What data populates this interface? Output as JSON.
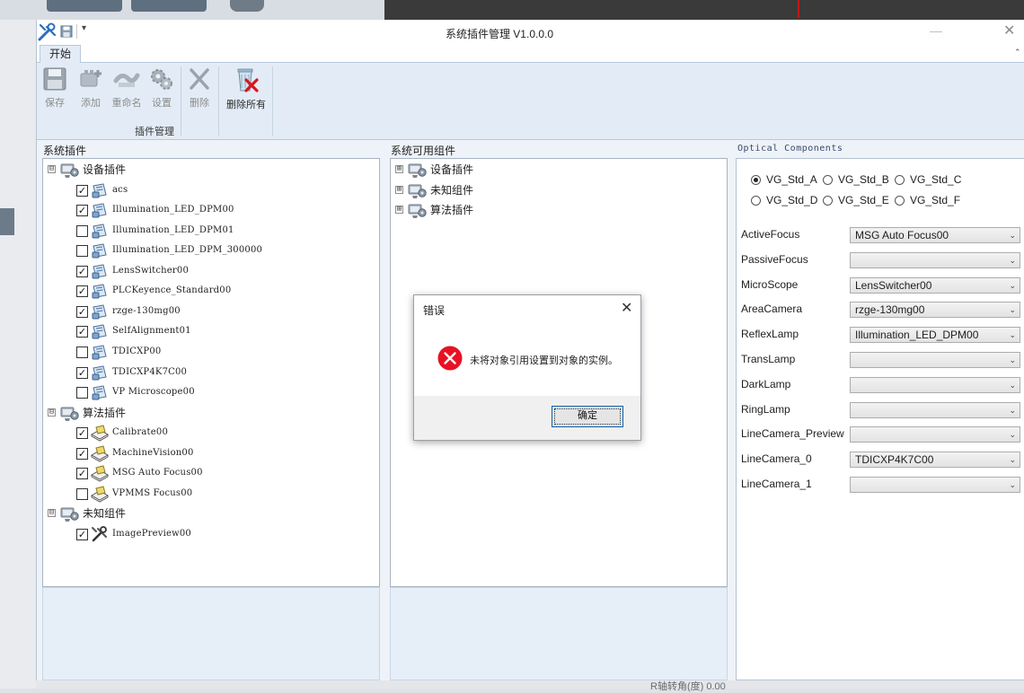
{
  "window": {
    "title": "系统插件管理 V1.0.0.0",
    "minimize_glyph": "—",
    "close_glyph": "✕",
    "qat_more_glyph": "▾",
    "collapse_glyph": "⌃"
  },
  "ribbon": {
    "tab_label": "开始",
    "group_label": "插件管理",
    "buttons": {
      "save": {
        "label": "保存",
        "icon": "floppy-icon"
      },
      "add": {
        "label": "添加",
        "icon": "add-plugin-icon"
      },
      "rename": {
        "label": "重命名",
        "icon": "rename-icon"
      },
      "settings": {
        "label": "设置",
        "icon": "gears-icon"
      },
      "delete": {
        "label": "删除",
        "icon": "delete-x-icon"
      },
      "delete_all": {
        "label": "删除所有",
        "icon": "recycle-bin-delete-icon"
      }
    }
  },
  "system_plugins": {
    "title": "系统插件",
    "groups": [
      {
        "label": "设备插件",
        "expanded": true,
        "expander": "⊟",
        "items": [
          {
            "label": "acs",
            "checked": true
          },
          {
            "label": "Illumination_LED_DPM00",
            "checked": true
          },
          {
            "label": "Illumination_LED_DPM01",
            "checked": false
          },
          {
            "label": "Illumination_LED_DPM_300000",
            "checked": false
          },
          {
            "label": "LensSwitcher00",
            "checked": true
          },
          {
            "label": "PLCKeyence_Standard00",
            "checked": true
          },
          {
            "label": "rzge-130mg00",
            "checked": true
          },
          {
            "label": "SelfAlignment01",
            "checked": true
          },
          {
            "label": "TDICXP00",
            "checked": false
          },
          {
            "label": "TDICXP4K7C00",
            "checked": true
          },
          {
            "label": "VP Microscope00",
            "checked": false
          }
        ]
      },
      {
        "label": "算法插件",
        "expanded": true,
        "expander": "⊟",
        "items": [
          {
            "label": "Calibrate00",
            "checked": true
          },
          {
            "label": "MachineVision00",
            "checked": true
          },
          {
            "label": "MSG Auto Focus00",
            "checked": true
          },
          {
            "label": "VPMMS Focus00",
            "checked": false
          }
        ]
      },
      {
        "label": "未知组件",
        "expanded": true,
        "expander": "⊟",
        "items": [
          {
            "label": "ImagePreview00",
            "checked": true
          }
        ]
      }
    ]
  },
  "available_components": {
    "title": "系统可用组件",
    "groups": [
      {
        "label": "设备插件",
        "expander": "⊞"
      },
      {
        "label": "未知组件",
        "expander": "⊞"
      },
      {
        "label": "算法插件",
        "expander": "⊞"
      }
    ]
  },
  "optical_components": {
    "title": "Optical Components",
    "radios": [
      {
        "label": "VG_Std_A",
        "selected": true
      },
      {
        "label": "VG_Std_B",
        "selected": false
      },
      {
        "label": "VG_Std_C",
        "selected": false
      },
      {
        "label": "VG_Std_D",
        "selected": false
      },
      {
        "label": "VG_Std_E",
        "selected": false
      },
      {
        "label": "VG_Std_F",
        "selected": false
      }
    ],
    "properties": [
      {
        "label": "ActiveFocus",
        "value": "MSG Auto Focus00"
      },
      {
        "label": "PassiveFocus",
        "value": ""
      },
      {
        "label": "MicroScope",
        "value": "LensSwitcher00"
      },
      {
        "label": "AreaCamera",
        "value": "rzge-130mg00"
      },
      {
        "label": "ReflexLamp",
        "value": "Illumination_LED_DPM00"
      },
      {
        "label": "TransLamp",
        "value": ""
      },
      {
        "label": "DarkLamp",
        "value": ""
      },
      {
        "label": "RingLamp",
        "value": ""
      },
      {
        "label": "LineCamera_Preview",
        "value": ""
      },
      {
        "label": "LineCamera_0",
        "value": "TDICXP4K7C00"
      },
      {
        "label": "LineCamera_1",
        "value": ""
      }
    ],
    "combo_arrow": "⌄"
  },
  "error_dialog": {
    "title": "错误",
    "message": "未将对象引用设置到对象的实例。",
    "ok_label": "确定",
    "close_glyph": "✕",
    "icon": "error-circle-icon",
    "accent": "#e81123"
  },
  "background": {
    "bottom_text": "R轴转角(度)  0.00"
  },
  "colors": {
    "ribbon_bg": "#e3ecf6",
    "panel_bg": "#eef3f9",
    "footer_bg": "#e6eef8",
    "error_red": "#e81123"
  }
}
